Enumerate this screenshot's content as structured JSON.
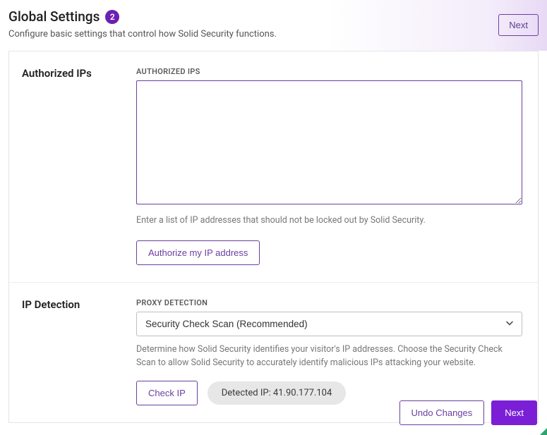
{
  "header": {
    "title": "Global Settings",
    "badge": "2",
    "subtitle": "Configure basic settings that control how Solid Security functions.",
    "next_label": "Next"
  },
  "authorized": {
    "section_label": "Authorized IPs",
    "caption": "AUTHORIZED IPS",
    "textarea_value": "",
    "help": "Enter a list of IP addresses that should not be locked out by Solid Security.",
    "authorize_btn": "Authorize my IP address"
  },
  "ipdetect": {
    "section_label": "IP Detection",
    "caption": "PROXY DETECTION",
    "selected": "Security Check Scan (Recommended)",
    "help": "Determine how Solid Security identifies your visitor's IP addresses. Choose the Security Check Scan to allow Solid Security to accurately identify malicious IPs attacking your website.",
    "check_btn": "Check IP",
    "detected_label": "Detected IP: 41.90.177.104"
  },
  "footer": {
    "undo": "Undo Changes",
    "next": "Next"
  }
}
